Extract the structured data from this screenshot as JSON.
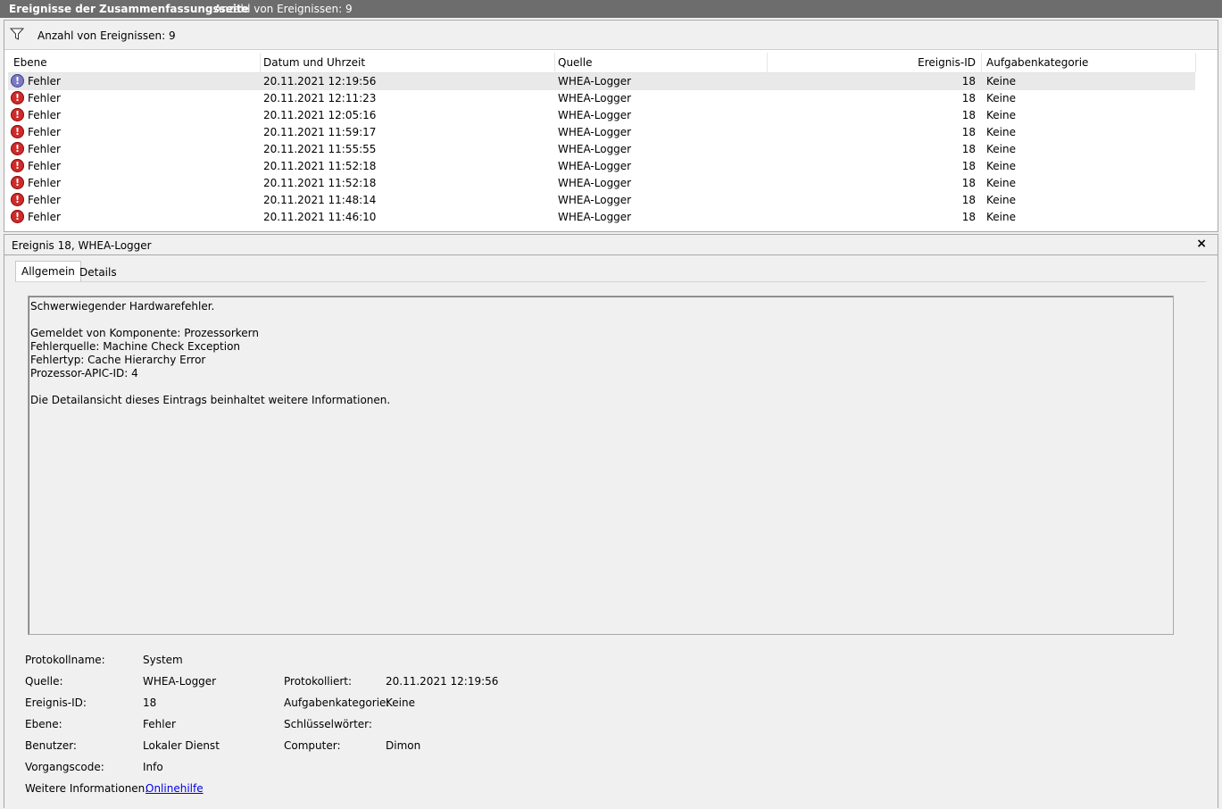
{
  "titlebar": {
    "title": "Ereignisse der Zusammenfassungsseite",
    "count": "Anzahl von Ereignissen: 9"
  },
  "filter": {
    "text": "Anzahl von Ereignissen: 9"
  },
  "table": {
    "headers": [
      "Ebene",
      "Datum und Uhrzeit",
      "Quelle",
      "Ereignis-ID",
      "Aufgabenkategorie"
    ],
    "rows": [
      {
        "level": "Fehler",
        "date": "20.11.2021 12:19:56",
        "source": "WHEA-Logger",
        "id": "18",
        "category": "Keine"
      },
      {
        "level": "Fehler",
        "date": "20.11.2021 12:11:23",
        "source": "WHEA-Logger",
        "id": "18",
        "category": "Keine"
      },
      {
        "level": "Fehler",
        "date": "20.11.2021 12:05:16",
        "source": "WHEA-Logger",
        "id": "18",
        "category": "Keine"
      },
      {
        "level": "Fehler",
        "date": "20.11.2021 11:59:17",
        "source": "WHEA-Logger",
        "id": "18",
        "category": "Keine"
      },
      {
        "level": "Fehler",
        "date": "20.11.2021 11:55:55",
        "source": "WHEA-Logger",
        "id": "18",
        "category": "Keine"
      },
      {
        "level": "Fehler",
        "date": "20.11.2021 11:52:18",
        "source": "WHEA-Logger",
        "id": "18",
        "category": "Keine"
      },
      {
        "level": "Fehler",
        "date": "20.11.2021 11:52:18",
        "source": "WHEA-Logger",
        "id": "18",
        "category": "Keine"
      },
      {
        "level": "Fehler",
        "date": "20.11.2021 11:48:14",
        "source": "WHEA-Logger",
        "id": "18",
        "category": "Keine"
      },
      {
        "level": "Fehler",
        "date": "20.11.2021 11:46:10",
        "source": "WHEA-Logger",
        "id": "18",
        "category": "Keine"
      }
    ]
  },
  "detail": {
    "title": "Ereignis 18, WHEA-Logger",
    "close": "×",
    "tabs": {
      "general": "Allgemein",
      "details": "Details"
    },
    "description": {
      "line1": "Schwerwiegender Hardwarefehler.",
      "line2": "Gemeldet von Komponente: Prozessorkern",
      "line3": "Fehlerquelle: Machine Check Exception",
      "line4": "Fehlertyp: Cache Hierarchy Error",
      "line5": "Prozessor-APIC-ID: 4",
      "line6": "Die Detailansicht dieses Eintrags beinhaltet weitere Informationen."
    },
    "props": {
      "logname_label": "Protokollname:",
      "logname": "System",
      "source_label": "Quelle:",
      "source": "WHEA-Logger",
      "logged_label": "Protokolliert:",
      "logged": "20.11.2021 12:19:56",
      "eventid_label": "Ereignis-ID:",
      "eventid": "18",
      "category_label": "Aufgabenkategorie:",
      "category": "Keine",
      "level_label": "Ebene:",
      "level": "Fehler",
      "keywords_label": "Schlüsselwörter:",
      "user_label": "Benutzer:",
      "user": "Lokaler Dienst",
      "computer_label": "Computer:",
      "computer": "Dimon",
      "opcode_label": "Vorgangscode:",
      "opcode": "Info",
      "moreinfo_label": "Weitere Informationen:",
      "moreinfo_link": "Onlinehilfe"
    }
  },
  "icons": {
    "filter": "filter-icon",
    "error": "error-icon",
    "close": "close-icon"
  }
}
